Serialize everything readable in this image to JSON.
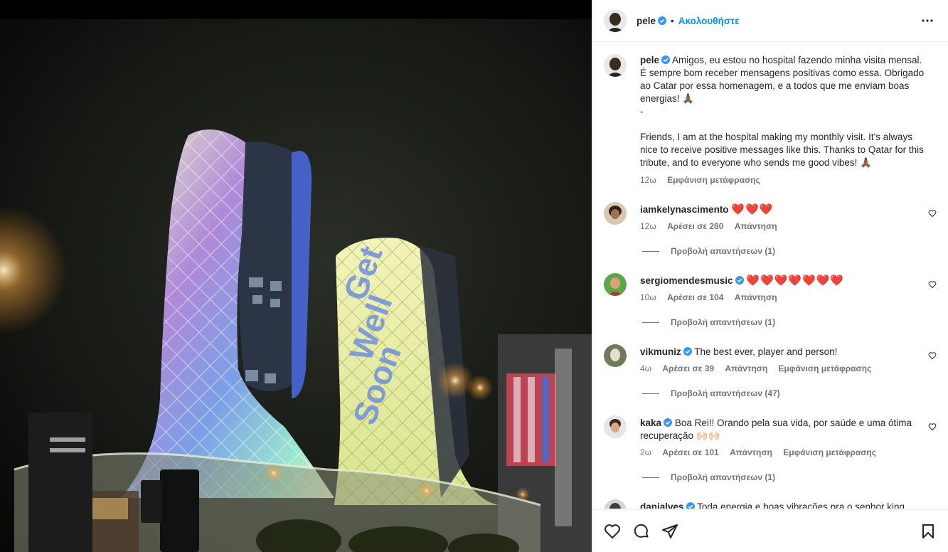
{
  "header": {
    "username": "pele",
    "separator": "•",
    "follow_label": "Ακολουθήστε"
  },
  "caption": {
    "username": "pele",
    "text_pt": "Amigos, eu estou no hospital fazendo minha visita mensal. É sempre bom receber mensagens positivas como essa. Obrigado ao Catar por essa homenagem, e a todos que me enviam boas energias! 🙏🏾",
    "dash": "-",
    "text_en": "Friends, I am at the hospital making my monthly visit. It's always nice to receive positive messages like this. Thanks to Qatar for this tribute, and to everyone who sends me good vibes! 🙏🏾",
    "time": "12ω",
    "translate": "Εμφάνιση μετάφρασης"
  },
  "comments": [
    {
      "username": "iamkelynascimento",
      "verified": false,
      "text": "❤️❤️❤️",
      "time": "12ω",
      "likes": "Αρέσει σε 280",
      "reply": "Απάντηση",
      "translate": "",
      "view_replies": "Προβολή απαντήσεων (1)"
    },
    {
      "username": "sergiomendesmusic",
      "verified": true,
      "text": "❤️❤️❤️❤️❤️❤️❤️",
      "time": "10ω",
      "likes": "Αρέσει σε 104",
      "reply": "Απάντηση",
      "translate": "",
      "view_replies": "Προβολή απαντήσεων (1)"
    },
    {
      "username": "vikmuniz",
      "verified": true,
      "text": "The best ever, player and person!",
      "time": "4ω",
      "likes": "Αρέσει σε 39",
      "reply": "Απάντηση",
      "translate": "Εμφάνιση μετάφρασης",
      "view_replies": "Προβολή απαντήσεων (47)"
    },
    {
      "username": "kaka",
      "verified": true,
      "text": "Boa Rei!! Orando pela sua vida, por saúde e uma ótima recuperação 🙌🏻🙌🏻",
      "time": "2ω",
      "likes": "Αρέσει σε 101",
      "reply": "Απάντηση",
      "translate": "Εμφάνιση μετάφρασης",
      "view_replies": "Προβολή απαντήσεων (1)"
    },
    {
      "username": "danialves",
      "verified": true,
      "text": "Toda energia e boas vibrações pra o senhor king"
    }
  ],
  "photo": {
    "building_text": "Get Well Soon"
  },
  "colors": {
    "link": "#0095f6",
    "verified": "#3897f0",
    "muted": "#737373",
    "text": "#262626"
  },
  "icons": [
    "more-icon",
    "verified-icon",
    "like-icon",
    "comment-icon",
    "share-icon",
    "save-icon",
    "heart-outline-icon"
  ]
}
